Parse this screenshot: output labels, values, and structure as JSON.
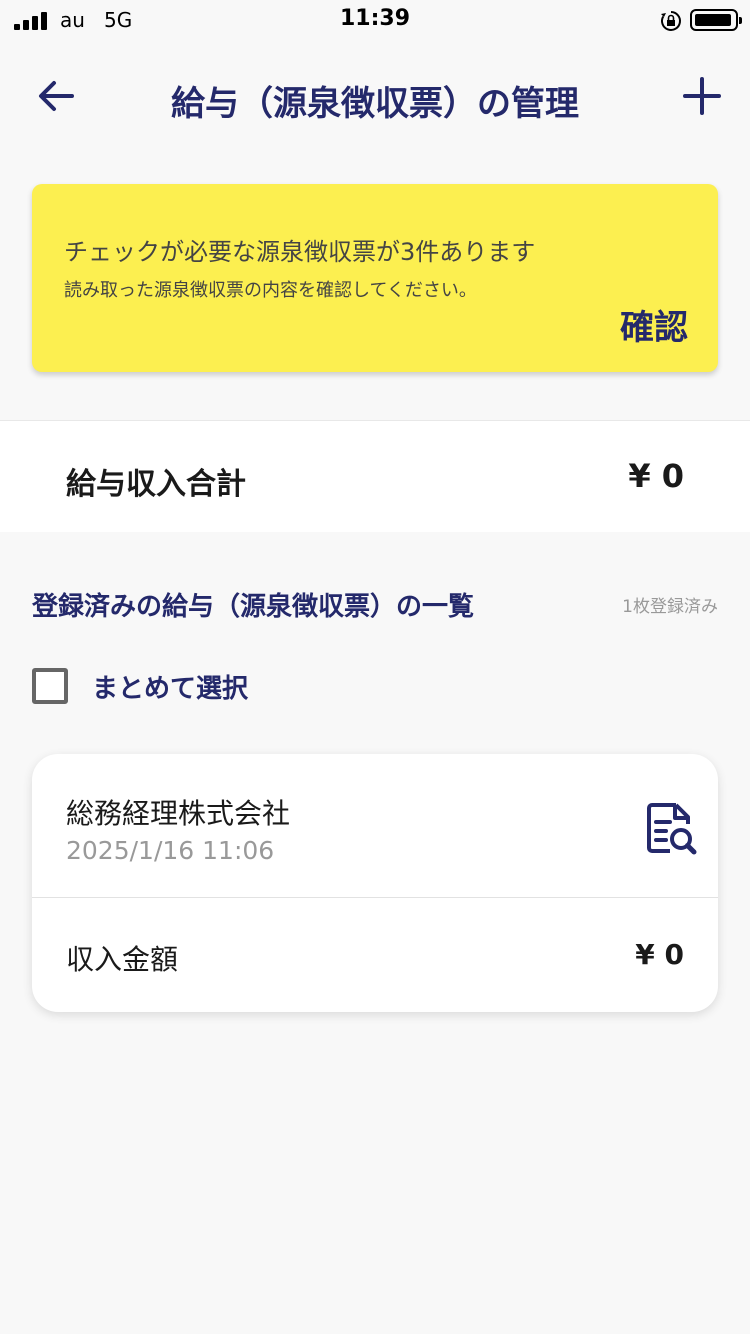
{
  "status_bar": {
    "carrier": "au",
    "network": "5G",
    "time": "11:39"
  },
  "nav": {
    "title": "給与（源泉徴収票）の管理",
    "back_icon": "arrow-left-icon",
    "add_icon": "plus-icon"
  },
  "alert": {
    "title": "チェックが必要な源泉徴収票が3件あります",
    "subtitle": "読み取った源泉徴収票の内容を確認してください。",
    "confirm_label": "確認"
  },
  "total": {
    "label": "給与収入合計",
    "value": "¥ 0"
  },
  "list": {
    "title": "登録済みの給与（源泉徴収票）の一覧",
    "count": "1枚登録済み",
    "select_all_label": "まとめて選択",
    "items": [
      {
        "company": "総務経理株式会社",
        "date": "2025/1/16 11:06",
        "income_label": "収入金額",
        "income_value": "¥ 0"
      }
    ]
  },
  "colors": {
    "brand_navy": "#24296b",
    "alert_yellow": "#fcef50",
    "background": "#f8f8f8"
  }
}
